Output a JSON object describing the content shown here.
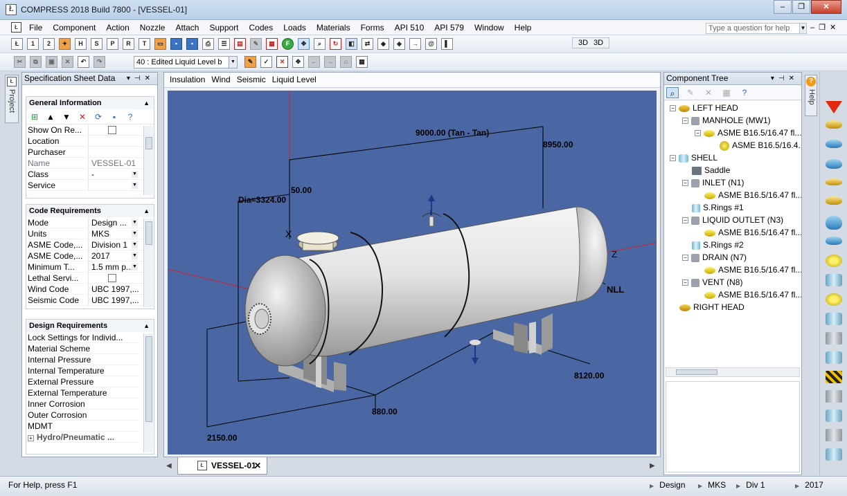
{
  "window": {
    "title": "COMPRESS 2018 Build 7800 - [VESSEL-01]"
  },
  "menu": {
    "items": [
      "File",
      "Component",
      "Action",
      "Nozzle",
      "Attach",
      "Support",
      "Codes",
      "Loads",
      "Materials",
      "Forms",
      "API 510",
      "API 579",
      "Window",
      "Help"
    ],
    "question_placeholder": "Type a question for help"
  },
  "toolbar": {
    "numbered_buttons": [
      "1",
      "2"
    ],
    "view_3d": [
      "3D",
      "3D"
    ],
    "load_case_combo": "40 : Edited Liquid Level b"
  },
  "left_tab": {
    "label": "Project"
  },
  "spec_panel": {
    "title": "Specification Sheet Data",
    "general": {
      "title": "General Information",
      "rows": [
        {
          "label": "Show On Re...",
          "value": ""
        },
        {
          "label": "Location",
          "value": ""
        },
        {
          "label": "Purchaser",
          "value": ""
        },
        {
          "label": "Name",
          "value": "VESSEL-01"
        },
        {
          "label": "Class",
          "value": "-"
        },
        {
          "label": "Service",
          "value": ""
        }
      ]
    },
    "code": {
      "title": "Code Requirements",
      "rows": [
        {
          "label": "Mode",
          "value": "Design ..."
        },
        {
          "label": "Units",
          "value": "MKS"
        },
        {
          "label": "ASME Code,...",
          "value": "Division 1"
        },
        {
          "label": "ASME Code,...",
          "value": "2017"
        },
        {
          "label": "Minimum T...",
          "value": "1.5 mm p..."
        },
        {
          "label": "Lethal Servi...",
          "value": ""
        },
        {
          "label": "Wind Code",
          "value": "UBC 1997,..."
        },
        {
          "label": "Seismic Code",
          "value": "UBC 1997,..."
        }
      ]
    },
    "design": {
      "title": "Design Requirements",
      "rows": [
        "Lock Settings for Individ...",
        "Material Scheme",
        "Internal Pressure",
        "Internal Temperature",
        "External Pressure",
        "External Temperature",
        "Inner Corrosion",
        "Outer Corrosion",
        "MDMT"
      ],
      "expandable": "Hydro/Pneumatic ..."
    }
  },
  "document": {
    "menu": [
      "Insulation",
      "Wind",
      "Seismic",
      "Liquid Level"
    ],
    "tab_label": "VESSEL-01",
    "dimensions": {
      "tan_tan": "9000.00 (Tan - Tan)",
      "right_height": "8950.00",
      "diameter": "Dia=3324.00",
      "nozzle_offset": "50.00",
      "nll": "NLL",
      "axis_z": "Z",
      "saddle_right": "8120.00",
      "saddle_width": "880.00",
      "saddle_left": "2150.00"
    }
  },
  "component_tree": {
    "title": "Component Tree",
    "nodes": [
      "LEFT HEAD",
      "MANHOLE (MW1)",
      "ASME B16.5/16.47 fl...",
      "ASME B16.5/16.4...",
      "SHELL",
      "Saddle",
      "INLET (N1)",
      "ASME B16.5/16.47 fl...",
      "S.Rings #1",
      "LIQUID OUTLET (N3)",
      "ASME B16.5/16.47 fl...",
      "S.Rings #2",
      "DRAIN (N7)",
      "ASME B16.5/16.47 fl...",
      "VENT (N8)",
      "ASME B16.5/16.47 fl...",
      "RIGHT HEAD"
    ]
  },
  "right_tab": {
    "label": "Help",
    "badge": "?"
  },
  "status": {
    "help": "For Help, press F1",
    "mode": "Design",
    "units": "MKS",
    "division": "Div 1",
    "year": "2017"
  },
  "colors": {
    "viewport_bg": "#4a67a3",
    "titlebar": "#c4d8ee",
    "accent": "#5d8ac2"
  }
}
